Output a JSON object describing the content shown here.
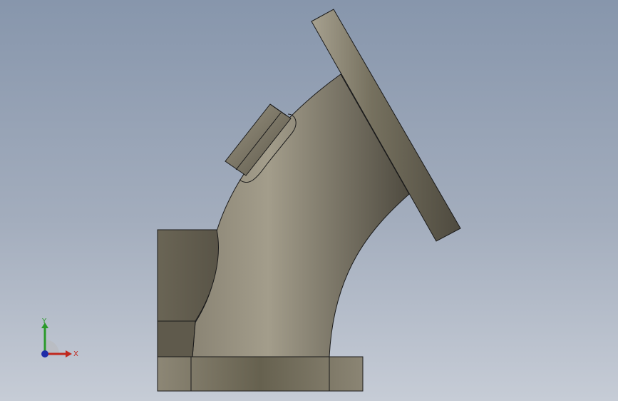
{
  "viewport": {
    "background_top": "#8796ac",
    "background_bottom": "#c6ccd6"
  },
  "part": {
    "body_color_light": "#a6a08f",
    "body_color_dark": "#5a5649",
    "edge_color": "#1a1a1a"
  },
  "triad": {
    "x_label": "X",
    "y_label": "Y",
    "x_color": "#c0281e",
    "y_color": "#2a9a2a",
    "z_color": "#1f2ca8"
  }
}
